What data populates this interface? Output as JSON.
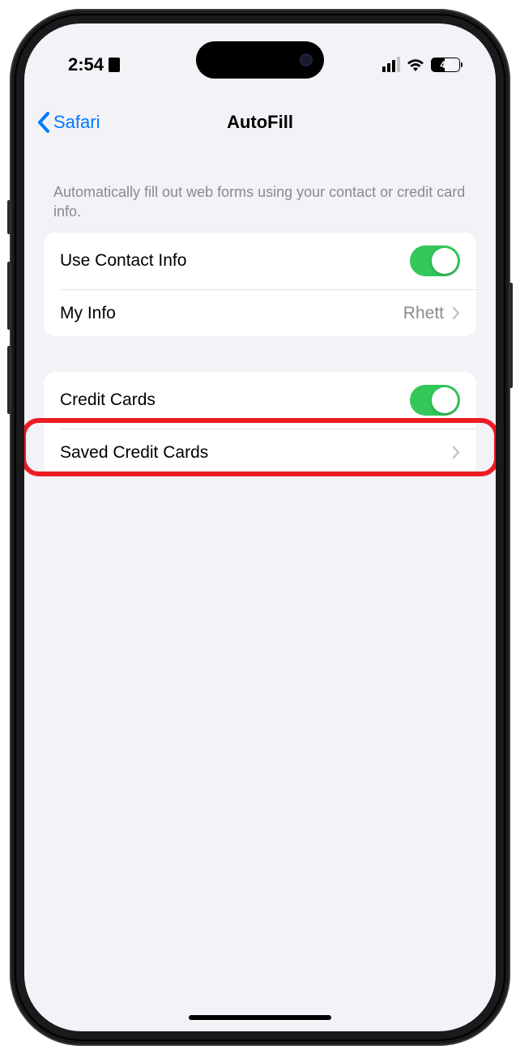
{
  "status": {
    "time": "2:54",
    "battery_pct": "47"
  },
  "nav": {
    "back_label": "Safari",
    "title": "AutoFill"
  },
  "description": "Automatically fill out web forms using your contact or credit card info.",
  "group1": {
    "contact_label": "Use Contact Info",
    "myinfo_label": "My Info",
    "myinfo_value": "Rhett"
  },
  "group2": {
    "cc_label": "Credit Cards",
    "saved_label": "Saved Credit Cards"
  }
}
